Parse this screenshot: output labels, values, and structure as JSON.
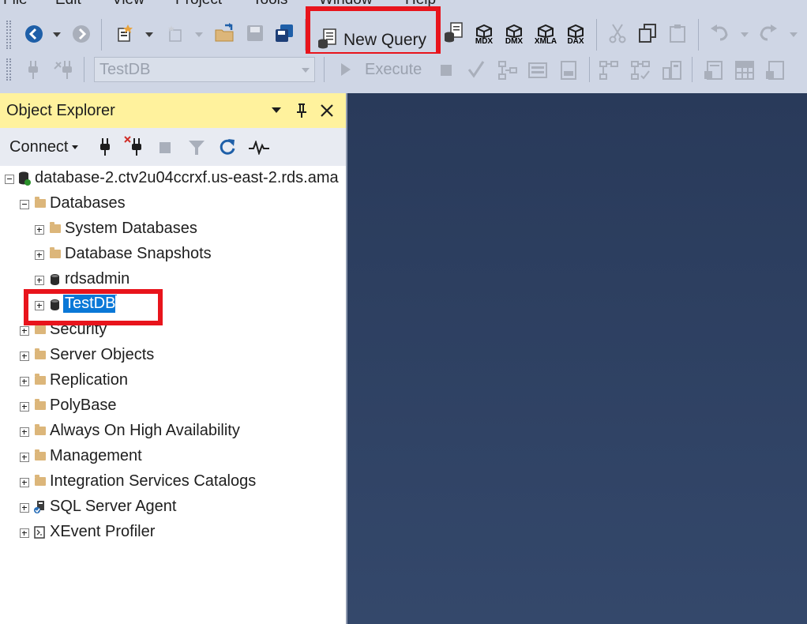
{
  "menu": [
    "File",
    "Edit",
    "View",
    "Project",
    "Tools",
    "Window",
    "Help"
  ],
  "toolbar1": {
    "new_query_label": "New Query",
    "mdx_label": "MDX",
    "dmx_label": "DMX",
    "xmla_label": "XMLA",
    "dax_label": "DAX"
  },
  "toolbar2": {
    "database_selected": "TestDB",
    "execute_label": "Execute"
  },
  "object_explorer": {
    "title": "Object Explorer",
    "connect_label": "Connect",
    "tree": [
      {
        "label": "database-2.ctv2u04ccrxf.us-east-2.rds.ama",
        "expanded": true,
        "icon": "server-icon"
      },
      {
        "label": "Databases",
        "expanded": true,
        "icon": "folder-icon"
      },
      {
        "label": "System Databases",
        "expanded": false,
        "icon": "folder-icon"
      },
      {
        "label": "Database Snapshots",
        "expanded": false,
        "icon": "folder-icon"
      },
      {
        "label": "rdsadmin",
        "expanded": false,
        "icon": "database-icon"
      },
      {
        "label": "TestDB",
        "expanded": false,
        "icon": "database-icon",
        "selected": true
      },
      {
        "label": "Security",
        "expanded": false,
        "icon": "folder-icon"
      },
      {
        "label": "Server Objects",
        "expanded": false,
        "icon": "folder-icon"
      },
      {
        "label": "Replication",
        "expanded": false,
        "icon": "folder-icon"
      },
      {
        "label": "PolyBase",
        "expanded": false,
        "icon": "folder-icon"
      },
      {
        "label": "Always On High Availability",
        "expanded": false,
        "icon": "folder-icon"
      },
      {
        "label": "Management",
        "expanded": false,
        "icon": "folder-icon"
      },
      {
        "label": "Integration Services Catalogs",
        "expanded": false,
        "icon": "folder-icon"
      },
      {
        "label": "SQL Server Agent",
        "expanded": false,
        "icon": "agent-icon"
      },
      {
        "label": "XEvent Profiler",
        "expanded": false,
        "icon": "profiler-icon"
      }
    ]
  },
  "colors": {
    "highlight_box": "#e8141c",
    "selection": "#0a78d7",
    "panel_title": "#fff29d",
    "editor_bg": "#293a5a"
  }
}
